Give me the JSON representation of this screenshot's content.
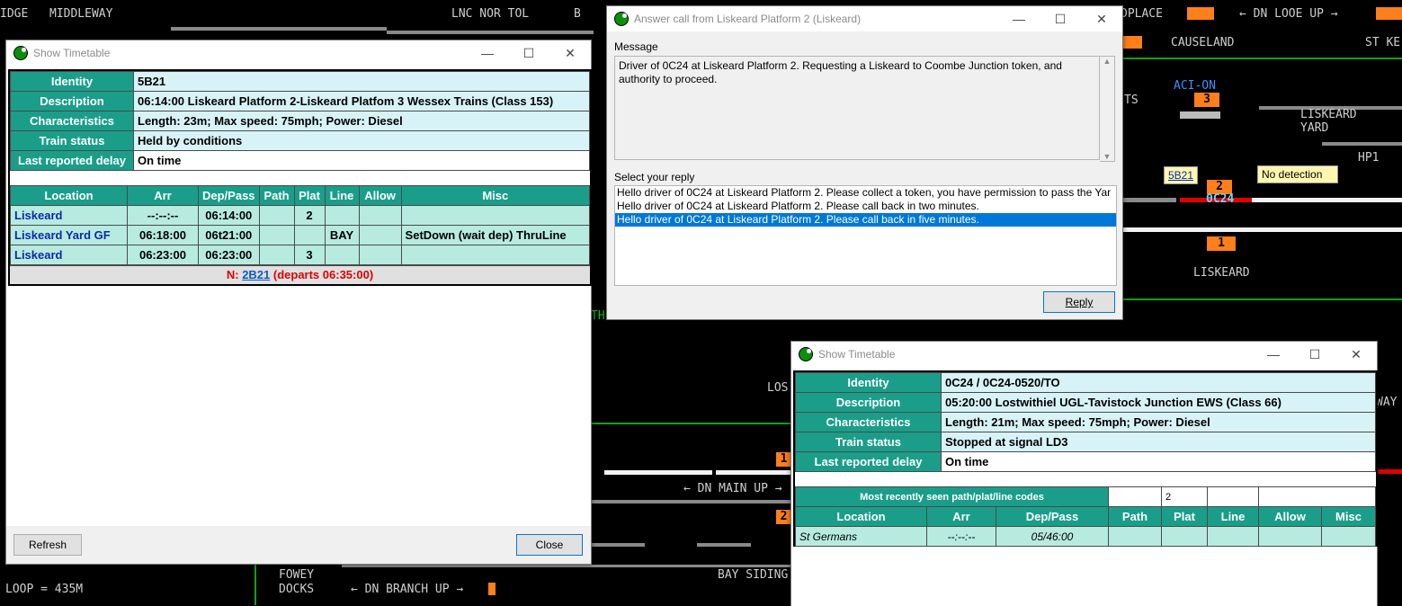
{
  "background": {
    "labels": {
      "ridge": "IDGE",
      "middleway": "MIDDLEWAY",
      "lnc_nor_tol": "LNC NOR TOL",
      "b": "B",
      "dnplace": "DPLACE",
      "dn_looe_up": "← DN LOOE UP →",
      "causeland": "CAUSELAND",
      "st_ke": "ST KE",
      "aci_on": "ACI-ON",
      "ts": "TS",
      "liskeard_yard": "LISKEARD\nYARD",
      "hp1": "HP1",
      "liskeard": "LISKEARD",
      "los": "LOS",
      "way": "WAY",
      "dn_main_up": "← DN MAIN UP →",
      "fowey_docks": "FOWEY\nDOCKS",
      "dn_branch_up": "← DN BRANCH UP →",
      "loop": "LOOP = 435M",
      "bay_siding": "BAY SIDING",
      "th": "TH",
      "train_0c24": "0C24",
      "box_3": "3",
      "box_2": "2",
      "box_1": "1",
      "box_1b": "1",
      "box_2b": "2",
      "tag_5b21": "5B21",
      "no_detection": "No detection"
    }
  },
  "timetable1": {
    "title": "Show Timetable",
    "info": [
      {
        "label": "Identity",
        "value": "5B21"
      },
      {
        "label": "Description",
        "value": "06:14:00 Liskeard Platform 2-Liskeard Platfom 3 Wessex Trains (Class 153)"
      },
      {
        "label": "Characteristics",
        "value": "Length: 23m; Max speed: 75mph; Power: Diesel"
      },
      {
        "label": "Train status",
        "value": "Held by conditions"
      },
      {
        "label": "Last reported delay",
        "value": "On time"
      }
    ],
    "columns": [
      "Location",
      "Arr",
      "Dep/Pass",
      "Path",
      "Plat",
      "Line",
      "Allow",
      "Misc"
    ],
    "rows": [
      [
        "Liskeard",
        "--:--:--",
        "06:14:00",
        "",
        "2",
        "",
        "",
        ""
      ],
      [
        "Liskeard Yard GF",
        "06:18:00",
        "06t21:00",
        "",
        "",
        "BAY",
        "",
        "SetDown (wait dep) ThruLine"
      ],
      [
        "Liskeard",
        "06:23:00",
        "06:23:00",
        "",
        "3",
        "",
        "",
        ""
      ]
    ],
    "next_prefix": "N: ",
    "next_link": "2B21",
    "next_suffix": " (departs 06:35:00)",
    "refresh_label": "Refresh",
    "close_label": "Close"
  },
  "dialog": {
    "title": "Answer call from Liskeard Platform 2 (Liskeard)",
    "message_label": "Message",
    "message": "Driver of 0C24 at Liskeard Platform 2. Requesting a Liskeard to Coombe Junction token, and authority to proceed.",
    "reply_label": "Select your reply",
    "replies": [
      "Hello driver of 0C24 at Liskeard Platform 2. Please collect a token, you have permission to pass the Yar",
      "Hello driver of 0C24 at Liskeard Platform 2. Please call back in two minutes.",
      "Hello driver of 0C24 at Liskeard Platform 2. Please call back in five minutes."
    ],
    "selected_index": 2,
    "reply_button": "Reply"
  },
  "timetable2": {
    "title": "Show Timetable",
    "info": [
      {
        "label": "Identity",
        "value": "0C24 / 0C24-0520/TO"
      },
      {
        "label": "Description",
        "value": "05:20:00 Lostwithiel UGL-Tavistock Junction EWS (Class 66)"
      },
      {
        "label": "Characteristics",
        "value": "Length: 21m; Max speed: 75mph; Power: Diesel"
      },
      {
        "label": "Train status",
        "value": "Stopped at signal LD3"
      },
      {
        "label": "Last reported delay",
        "value": "On time"
      }
    ],
    "recent_label": "Most recently seen path/plat/line codes",
    "recent_values": [
      "",
      "2",
      "",
      ""
    ],
    "columns": [
      "Location",
      "Arr",
      "Dep/Pass",
      "Path",
      "Plat",
      "Line",
      "Allow",
      "Misc"
    ],
    "rows": [
      [
        "St Germans",
        "--:--:--",
        "05/46:00",
        "",
        "",
        "",
        "",
        ""
      ]
    ]
  },
  "colors": {
    "header_teal": "#1a9e8a",
    "value_cyan": "#d8f3f7",
    "row_green": "#b7ebdf",
    "selection_blue": "#0078d7",
    "track_orange": "#ff7f1a"
  }
}
